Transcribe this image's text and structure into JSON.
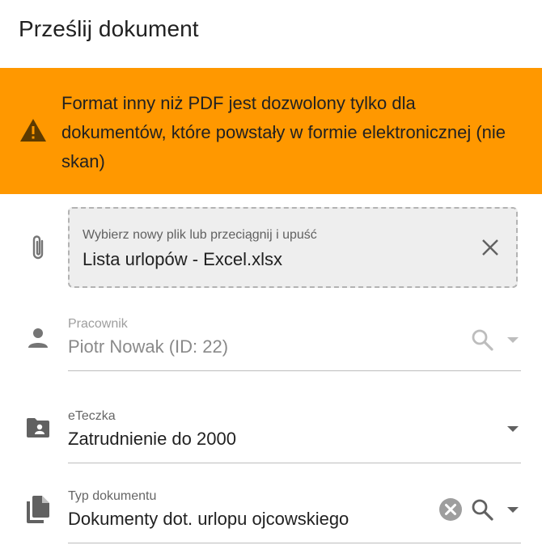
{
  "dialog": {
    "title": "Prześlij dokument"
  },
  "warning": {
    "icon": "warning-triangle-icon",
    "color": "#ff9800",
    "text": "Format inny niż PDF jest dozwolony tylko dla dokumentów, które powstały w formie elektronicznej (nie skan)"
  },
  "file": {
    "icon": "paperclip-icon",
    "label": "Wybierz nowy plik lub przeciągnij i upuść",
    "value": "Lista urlopów - Excel.xlsx",
    "clear_icon": "close-icon"
  },
  "employee": {
    "icon": "person-icon",
    "label": "Pracownik",
    "value": "Piotr Nowak (ID: 22)",
    "disabled": true
  },
  "folder": {
    "icon": "folder-account-icon",
    "label": "eTeczka",
    "value": "Zatrudnienie do 2000"
  },
  "doc_type": {
    "icon": "documents-icon",
    "label": "Typ dokumentu",
    "value": "Dokumenty dot. urlopu ojcowskiego"
  }
}
